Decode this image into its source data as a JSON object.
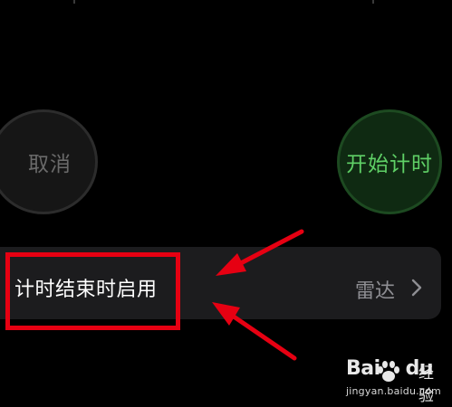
{
  "timer": {
    "cancel_label": "取消",
    "start_label": "开始计时"
  },
  "settings_row": {
    "label": "计时结束时启用",
    "value": "雷达",
    "chevron_icon": "chevron-right-icon"
  },
  "annotation": {
    "highlight_color": "#e60012",
    "arrow_color": "#e60012"
  },
  "watermark": {
    "brand_left": "Bai",
    "brand_icon": "paw-icon",
    "brand_right": "du",
    "product": "经验",
    "url": "jingyan.baidu.com"
  },
  "colors": {
    "background": "#000000",
    "start_green": "#5fd066",
    "cancel_gray": "#6a6a6a",
    "row_background": "#1c1c1e",
    "value_gray": "#8e8e93"
  }
}
